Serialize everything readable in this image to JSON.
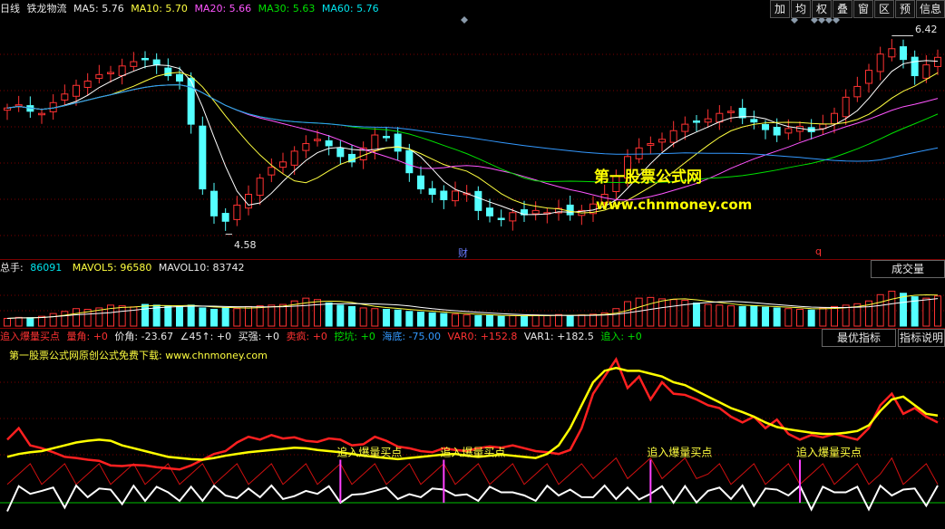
{
  "colors": {
    "up": "#ff3232",
    "down": "#54ffff",
    "ma5": "#ffffff",
    "ma10": "#ffff40",
    "ma20": "#ff55ff",
    "ma30": "#00e000",
    "ma60": "#3399ff",
    "grid": "#7a0000"
  },
  "header": {
    "period": "日线",
    "stock": "铁龙物流",
    "ma5": "MA5: 5.76",
    "ma10": "MA10: 5.70",
    "ma20": "MA20: 5.66",
    "ma30": "MA30: 5.63",
    "ma60": "MA60: 5.76",
    "buttons": [
      "加",
      "均",
      "权",
      "叠",
      "窗",
      "区",
      "预"
    ],
    "info_button": "信息"
  },
  "price_panel": {
    "high_label": "6.42",
    "low_label": "4.58",
    "event_cai": "财",
    "event_q": "q"
  },
  "volume_panel": {
    "prefix": "总手: ",
    "value": "86091",
    "mavol5": "MAVOL5: 96580",
    "mavol10": "MAVOL10: 83742",
    "button": "成交量"
  },
  "indicator_panel": {
    "name": "追入爆量买点",
    "items": [
      {
        "text": "量角: +0",
        "color": "red"
      },
      {
        "text": "价角: -23.67",
        "color": "white"
      },
      {
        "text": "∠45↑: +0",
        "color": "white"
      },
      {
        "text": "买强: +0",
        "color": "white"
      },
      {
        "text": "卖疯: +0",
        "color": "red"
      },
      {
        "text": "挖坑: +0",
        "color": "green"
      },
      {
        "text": "海底: -75.00",
        "color": "blue"
      },
      {
        "text": "VAR0: +152.8",
        "color": "red"
      },
      {
        "text": "VAR1: +182.5",
        "color": "white"
      },
      {
        "text": "追入: +0",
        "color": "green"
      }
    ],
    "btn_best": "最优指标",
    "btn_help": "指标说明",
    "note": "第一股票公式网原创公式免费下载: www.chnmoney.com",
    "signal_label": "追入爆量买点"
  },
  "watermark": {
    "line1": "第一股票公式网",
    "line2": "www.chnmoney.com"
  },
  "chart_data": {
    "type": "candlestick",
    "price_range": [
      4.4,
      6.55
    ],
    "close": [
      5.75,
      5.78,
      5.72,
      5.7,
      5.8,
      5.88,
      5.96,
      6.0,
      6.06,
      6.08,
      6.14,
      6.18,
      6.2,
      6.15,
      6.05,
      6.0,
      5.6,
      5.0,
      4.75,
      4.7,
      4.85,
      4.95,
      5.1,
      5.2,
      5.25,
      5.35,
      5.42,
      5.46,
      5.4,
      5.3,
      5.25,
      5.38,
      5.5,
      5.48,
      5.35,
      5.15,
      5.0,
      4.95,
      4.9,
      4.98,
      4.96,
      4.8,
      4.75,
      4.72,
      4.78,
      4.76,
      4.8,
      4.78,
      4.82,
      4.76,
      4.8,
      4.86,
      4.95,
      5.12,
      5.3,
      5.38,
      5.42,
      5.46,
      5.54,
      5.6,
      5.62,
      5.65,
      5.7,
      5.72,
      5.66,
      5.62,
      5.55,
      5.5,
      5.56,
      5.58,
      5.53,
      5.6,
      5.7,
      5.85,
      5.95,
      6.1,
      6.25,
      6.3,
      6.2,
      6.05,
      6.15,
      6.22
    ],
    "volume_range": [
      0,
      140000
    ],
    "volume": [
      22000,
      25000,
      24000,
      28000,
      36000,
      42000,
      50000,
      48000,
      52000,
      60000,
      58000,
      55000,
      62000,
      60000,
      58000,
      56000,
      60000,
      52000,
      48000,
      52000,
      50000,
      56000,
      58000,
      60000,
      62000,
      72000,
      80000,
      76000,
      66000,
      60000,
      56000,
      52000,
      50000,
      48000,
      46000,
      42000,
      40000,
      38000,
      36000,
      34000,
      32000,
      30000,
      30000,
      28000,
      30000,
      29000,
      32000,
      30000,
      33000,
      30000,
      32000,
      34000,
      38000,
      50000,
      70000,
      80000,
      82000,
      78000,
      76000,
      74000,
      66000,
      62000,
      60000,
      58000,
      56000,
      58000,
      54000,
      52000,
      50000,
      48000,
      46000,
      52000,
      56000,
      60000,
      64000,
      72000,
      90000,
      100000,
      94000,
      84000,
      80000,
      86091
    ],
    "indicator_range": [
      -100,
      200
    ],
    "var0": [
      40,
      60,
      30,
      25,
      18,
      10,
      8,
      5,
      3,
      -5,
      -6,
      -4,
      -5,
      -8,
      -10,
      -12,
      -5,
      5,
      15,
      20,
      35,
      45,
      40,
      48,
      42,
      44,
      38,
      36,
      42,
      40,
      30,
      32,
      45,
      38,
      28,
      25,
      20,
      18,
      25,
      22,
      20,
      25,
      28,
      26,
      30,
      25,
      20,
      18,
      15,
      22,
      60,
      120,
      150,
      180,
      130,
      150,
      110,
      140,
      120,
      118,
      110,
      100,
      95,
      80,
      70,
      80,
      60,
      75,
      50,
      40,
      48,
      44,
      50,
      45,
      40,
      60,
      100,
      120,
      85,
      95,
      80,
      70
    ],
    "var1": [
      10,
      15,
      18,
      20,
      25,
      30,
      35,
      38,
      40,
      38,
      30,
      25,
      20,
      15,
      10,
      8,
      6,
      5,
      8,
      12,
      15,
      18,
      20,
      22,
      24,
      26,
      25,
      22,
      20,
      18,
      15,
      12,
      10,
      8,
      6,
      8,
      10,
      12,
      14,
      15,
      12,
      10,
      12,
      14,
      12,
      10,
      8,
      15,
      30,
      60,
      100,
      140,
      160,
      165,
      160,
      160,
      155,
      150,
      140,
      135,
      125,
      115,
      105,
      95,
      88,
      80,
      70,
      62,
      58,
      55,
      52,
      50,
      50,
      52,
      55,
      65,
      90,
      110,
      115,
      100,
      85,
      82
    ],
    "signals": [
      29,
      38,
      56,
      69
    ]
  }
}
